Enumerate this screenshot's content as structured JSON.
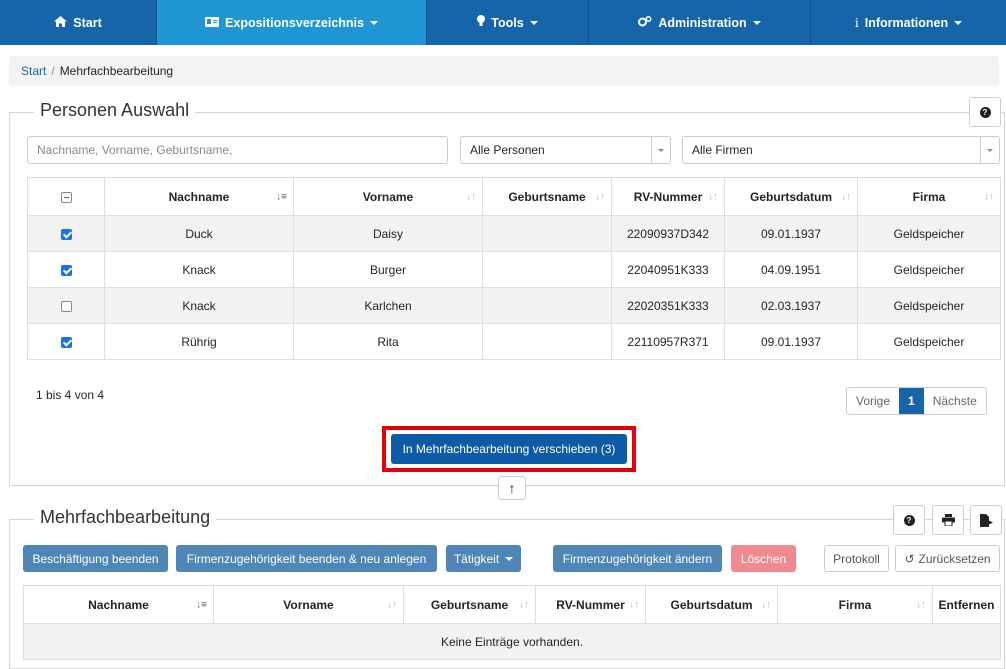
{
  "nav": {
    "start": "Start",
    "exposition": "Expositionsverzeichnis",
    "tools": "Tools",
    "admin": "Administration",
    "info": "Informationen"
  },
  "breadcrumb": {
    "home": "Start",
    "sep": "/",
    "current": "Mehrfachbearbeitung"
  },
  "selection": {
    "title": "Personen Auswahl",
    "search_placeholder": "Nachname, Vorname, Geburtsname,",
    "filter_persons": "Alle Personen",
    "filter_companies": "Alle Firmen",
    "columns": [
      "Nachname",
      "Vorname",
      "Geburtsname",
      "RV-Nummer",
      "Geburtsdatum",
      "Firma"
    ],
    "rows": [
      {
        "checked": true,
        "nachname": "Duck",
        "vorname": "Daisy",
        "geburtsname": "",
        "rv": "22090937D342",
        "geburtsdatum": "09.01.1937",
        "firma": "Geldspeicher"
      },
      {
        "checked": true,
        "nachname": "Knack",
        "vorname": "Burger",
        "geburtsname": "",
        "rv": "22040951K333",
        "geburtsdatum": "04.09.1951",
        "firma": "Geldspeicher"
      },
      {
        "checked": false,
        "nachname": "Knack",
        "vorname": "Karlchen",
        "geburtsname": "",
        "rv": "22020351K333",
        "geburtsdatum": "02.03.1937",
        "firma": "Geldspeicher"
      },
      {
        "checked": true,
        "nachname": "Rührig",
        "vorname": "Rita",
        "geburtsname": "",
        "rv": "22110957R371",
        "geburtsdatum": "09.01.1937",
        "firma": "Geldspeicher"
      }
    ],
    "info": "1 bis 4 von 4",
    "pager": {
      "prev": "Vorige",
      "page": "1",
      "next": "Nächste"
    },
    "move_button": "In Mehrfachbearbeitung verschieben (3)"
  },
  "bulk": {
    "title": "Mehrfachbearbeitung",
    "buttons": {
      "end_employment": "Beschäftigung beenden",
      "end_company_new": "Firmenzugehörigkeit beenden & neu anlegen",
      "activity": "Tätigkeit",
      "change_company": "Firmenzugehörigkeit ändern",
      "delete": "Löschen",
      "protocol": "Protokoll",
      "reset": "Zurücksetzen"
    },
    "columns": [
      "Nachname",
      "Vorname",
      "Geburtsname",
      "RV-Nummer",
      "Geburtsdatum",
      "Firma",
      "Entfernen"
    ],
    "empty": "Keine Einträge vorhanden."
  },
  "colors": {
    "nav": "#1565a8",
    "nav_active": "#1f96d3",
    "primary": "#0d5aa7",
    "highlight": "#e3000b",
    "danger": "#f08a8f"
  }
}
